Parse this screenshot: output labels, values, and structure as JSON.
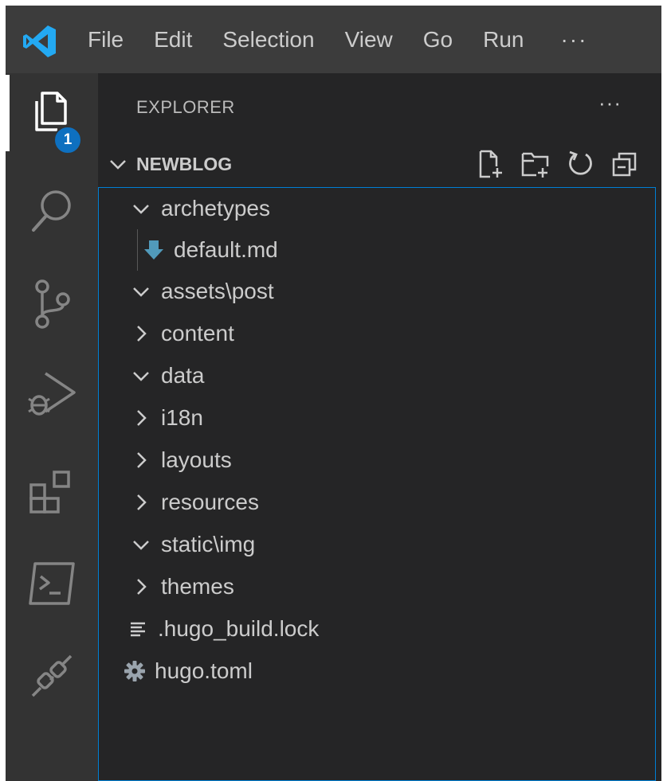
{
  "menu": {
    "items": [
      "File",
      "Edit",
      "Selection",
      "View",
      "Go",
      "Run"
    ],
    "more": "···"
  },
  "activity_bar": {
    "items": [
      {
        "icon": "files-icon",
        "badge": "1",
        "active": true
      },
      {
        "icon": "search-icon"
      },
      {
        "icon": "source-control-icon"
      },
      {
        "icon": "run-debug-icon"
      },
      {
        "icon": "extensions-icon"
      },
      {
        "icon": "terminal-icon"
      },
      {
        "icon": "remote-icon"
      }
    ]
  },
  "explorer": {
    "title": "EXPLORER",
    "more": "···",
    "section": {
      "title": "NEWBLOG",
      "actions": [
        "new-file-icon",
        "new-folder-icon",
        "refresh-icon",
        "collapse-all-icon"
      ]
    },
    "tree": [
      {
        "label": "archetypes",
        "kind": "folder",
        "expanded": true
      },
      {
        "label": "default.md",
        "kind": "markdown",
        "child": true
      },
      {
        "label": "assets\\post",
        "kind": "folder",
        "expanded": true
      },
      {
        "label": "content",
        "kind": "folder",
        "expanded": false
      },
      {
        "label": "data",
        "kind": "folder",
        "expanded": true
      },
      {
        "label": "i18n",
        "kind": "folder",
        "expanded": false
      },
      {
        "label": "layouts",
        "kind": "folder",
        "expanded": false
      },
      {
        "label": "resources",
        "kind": "folder",
        "expanded": false
      },
      {
        "label": "static\\img",
        "kind": "folder",
        "expanded": true
      },
      {
        "label": "themes",
        "kind": "folder",
        "expanded": false
      },
      {
        "label": ".hugo_build.lock",
        "kind": "text"
      },
      {
        "label": "hugo.toml",
        "kind": "config"
      }
    ]
  },
  "colors": {
    "accent": "#007fd4",
    "badge": "#0e70c0",
    "markdown_icon": "#519aba",
    "vscode_logo": "#23a9f2"
  }
}
